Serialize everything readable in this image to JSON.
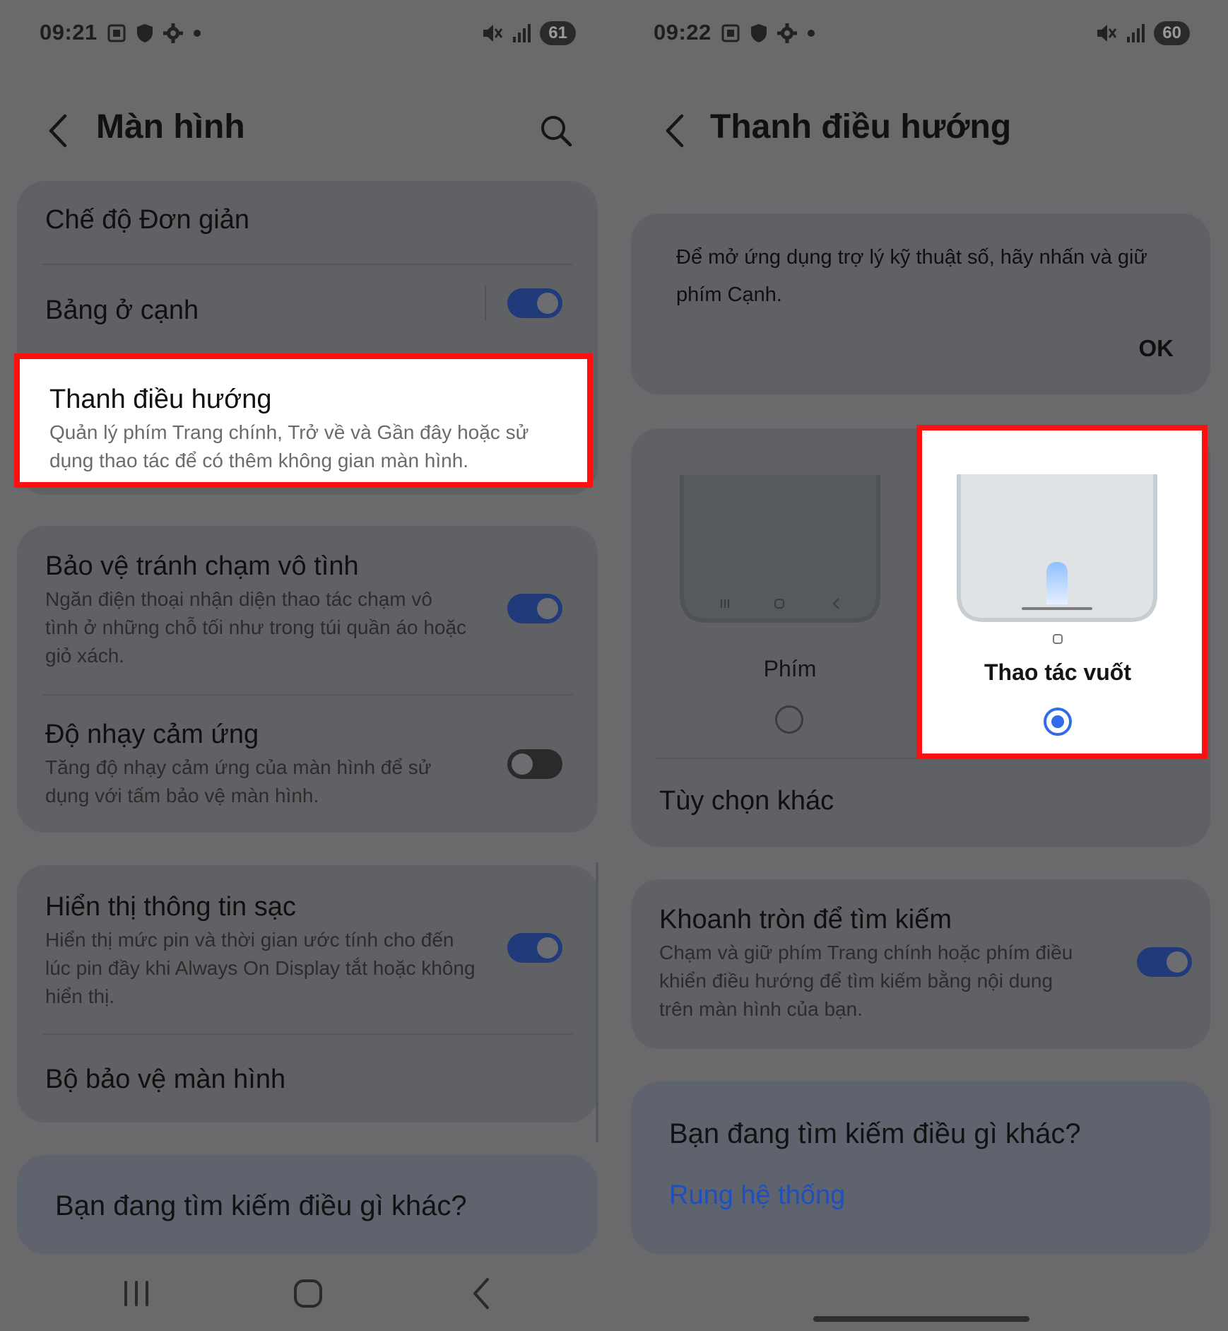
{
  "left": {
    "status": {
      "time": "09:21",
      "battery": "61"
    },
    "title": "Màn hình",
    "items": {
      "simple_mode": "Chế độ Đơn giản",
      "edge_panel": "Bảng ở cạnh",
      "nav_bar": {
        "title": "Thanh điều hướng",
        "sub": "Quản lý phím Trang chính, Trở về và Gần đây hoặc sử dụng thao tác để có thêm không gian màn hình."
      },
      "accidental": {
        "title": "Bảo vệ tránh chạm vô tình",
        "sub": "Ngăn điện thoại nhận diện thao tác chạm vô tình ở những chỗ tối như trong túi quần áo hoặc giỏ xách."
      },
      "touch": {
        "title": "Độ nhạy cảm ứng",
        "sub": "Tăng độ nhạy cảm ứng của màn hình để sử dụng với tấm bảo vệ màn hình."
      },
      "charging": {
        "title": "Hiển thị thông tin sạc",
        "sub": "Hiển thị mức pin và thời gian ước tính cho đến lúc pin đầy khi Always On Display tắt hoặc không hiển thị."
      },
      "screensaver": "Bộ bảo vệ màn hình"
    },
    "suggest": "Bạn đang tìm kiếm điều gì khác?"
  },
  "right": {
    "status": {
      "time": "09:22",
      "battery": "60"
    },
    "title": "Thanh điều hướng",
    "info": "Để mở ứng dụng trợ lý kỹ thuật số, hãy nhấn và giữ phím Cạnh.",
    "ok": "OK",
    "options": {
      "buttons": "Phím",
      "swipe": "Thao tác vuốt"
    },
    "more_options": "Tùy chọn khác",
    "circle": {
      "title": "Khoanh tròn để tìm kiếm",
      "sub": "Chạm và giữ phím Trang chính hoặc phím điều khiển điều hướng để tìm kiếm bằng nội dung trên màn hình của bạn."
    },
    "suggest": {
      "title": "Bạn đang tìm kiếm điều gì khác?",
      "link": "Rung hệ thống"
    }
  },
  "colors": {
    "accent": "#2f6bea",
    "highlight_border": "#ff1010",
    "link": "#1d4fbf"
  }
}
